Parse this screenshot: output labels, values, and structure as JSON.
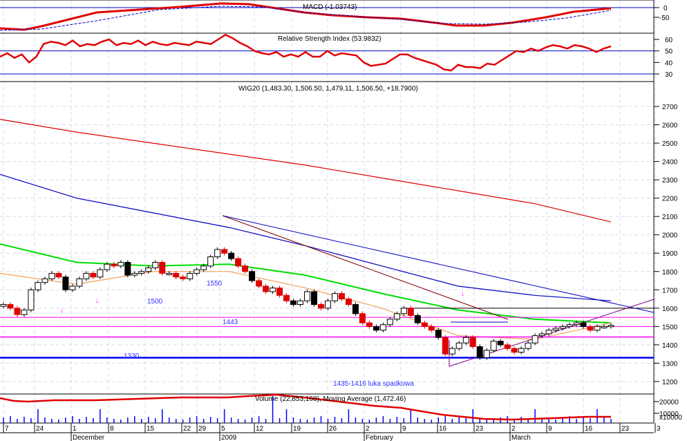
{
  "chart_data": {
    "type": "candlestick",
    "title": "WIG20 (1,483.30, 1,506.50, 1,479.11, 1,506.50, +18.7900)",
    "price_axis": {
      "ticks": [
        1200,
        1300,
        1400,
        1500,
        1600,
        1700,
        1800,
        1900,
        2000,
        2100,
        2200,
        2300,
        2400,
        2500,
        2600,
        2700
      ],
      "range": [
        1170,
        2760
      ]
    },
    "closes": [
      1620,
      1600,
      1565,
      1590,
      1700,
      1740,
      1760,
      1790,
      1770,
      1700,
      1720,
      1760,
      1790,
      1770,
      1810,
      1840,
      1830,
      1850,
      1780,
      1790,
      1800,
      1820,
      1850,
      1790,
      1790,
      1770,
      1760,
      1790,
      1810,
      1830,
      1880,
      1920,
      1900,
      1870,
      1830,
      1800,
      1750,
      1720,
      1690,
      1710,
      1670,
      1640,
      1620,
      1640,
      1690,
      1620,
      1600,
      1640,
      1680,
      1650,
      1620,
      1570,
      1520,
      1500,
      1480,
      1510,
      1540,
      1570,
      1600,
      1560,
      1520,
      1500,
      1480,
      1440,
      1350,
      1380,
      1410,
      1440,
      1390,
      1330,
      1370,
      1420,
      1400,
      1380,
      1360,
      1380,
      1410,
      1450,
      1460,
      1480,
      1490,
      1500,
      1510,
      1520,
      1500,
      1480,
      1500,
      1500,
      1506.5
    ],
    "moving_averages": [
      {
        "name": "MA red",
        "color": "#e00000",
        "values": [
          2630,
          2560,
          2500,
          2440,
          2380,
          2310,
          2240,
          2170,
          2070
        ]
      },
      {
        "name": "MA blue",
        "color": "#0000c0",
        "values": [
          2330,
          2200,
          2120,
          2040,
          1940,
          1830,
          1720,
          1670,
          1640
        ]
      },
      {
        "name": "MA green",
        "color": "#00dd00",
        "values": [
          1950,
          1850,
          1830,
          1840,
          1780,
          1680,
          1590,
          1540,
          1520
        ]
      },
      {
        "name": "MA orange",
        "color": "#f0a050",
        "values": [
          1790,
          1730,
          1800,
          1800,
          1710,
          1600,
          1450,
          1430,
          1520
        ]
      }
    ],
    "levels": [
      {
        "label": "1550",
        "value": 1550
      },
      {
        "label": "1500",
        "value": 1500
      },
      {
        "label": "1443",
        "value": 1443
      },
      {
        "label": "1330",
        "value": 1330
      }
    ],
    "annotation": "1435-1416 luka spadkowa",
    "macd": {
      "title": "MACD (-1.03743)",
      "ticks": [
        "0",
        "-50"
      ]
    },
    "rsi": {
      "title": "Relative Strength Index (53.9832)",
      "ticks": [
        "60",
        "50",
        "40",
        "30"
      ],
      "values": [
        45,
        48,
        44,
        47,
        40,
        45,
        56,
        58,
        57,
        55,
        59,
        54,
        56,
        55,
        58,
        60,
        55,
        57,
        56,
        59,
        55,
        58,
        56,
        55,
        57,
        56,
        55,
        58,
        57,
        56,
        60,
        64,
        61,
        57,
        54,
        50,
        48,
        47,
        49,
        45,
        47,
        45,
        49,
        45,
        45,
        50,
        46,
        48,
        47,
        46,
        40,
        37,
        38,
        39,
        43,
        47,
        47,
        44,
        42,
        40,
        38,
        34,
        33,
        38,
        36,
        36,
        35,
        39,
        38,
        42,
        46,
        50,
        49,
        52,
        50,
        53,
        55,
        54,
        52,
        55,
        54,
        52,
        49,
        52,
        54
      ]
    },
    "volume": {
      "title": "Volume (22,853,168), Moving Average (1,472.46)",
      "ticks": [
        "20000",
        "10000"
      ],
      "unit": "x10000"
    },
    "date_labels": [
      "7",
      "24",
      "1",
      "8",
      "15",
      "22",
      "29",
      "5",
      "12",
      "19",
      "26",
      "2",
      "9",
      "16",
      "23",
      "2",
      "9",
      "16",
      "23",
      "3"
    ],
    "month_labels": [
      "December",
      "2009",
      "February",
      "March"
    ]
  }
}
